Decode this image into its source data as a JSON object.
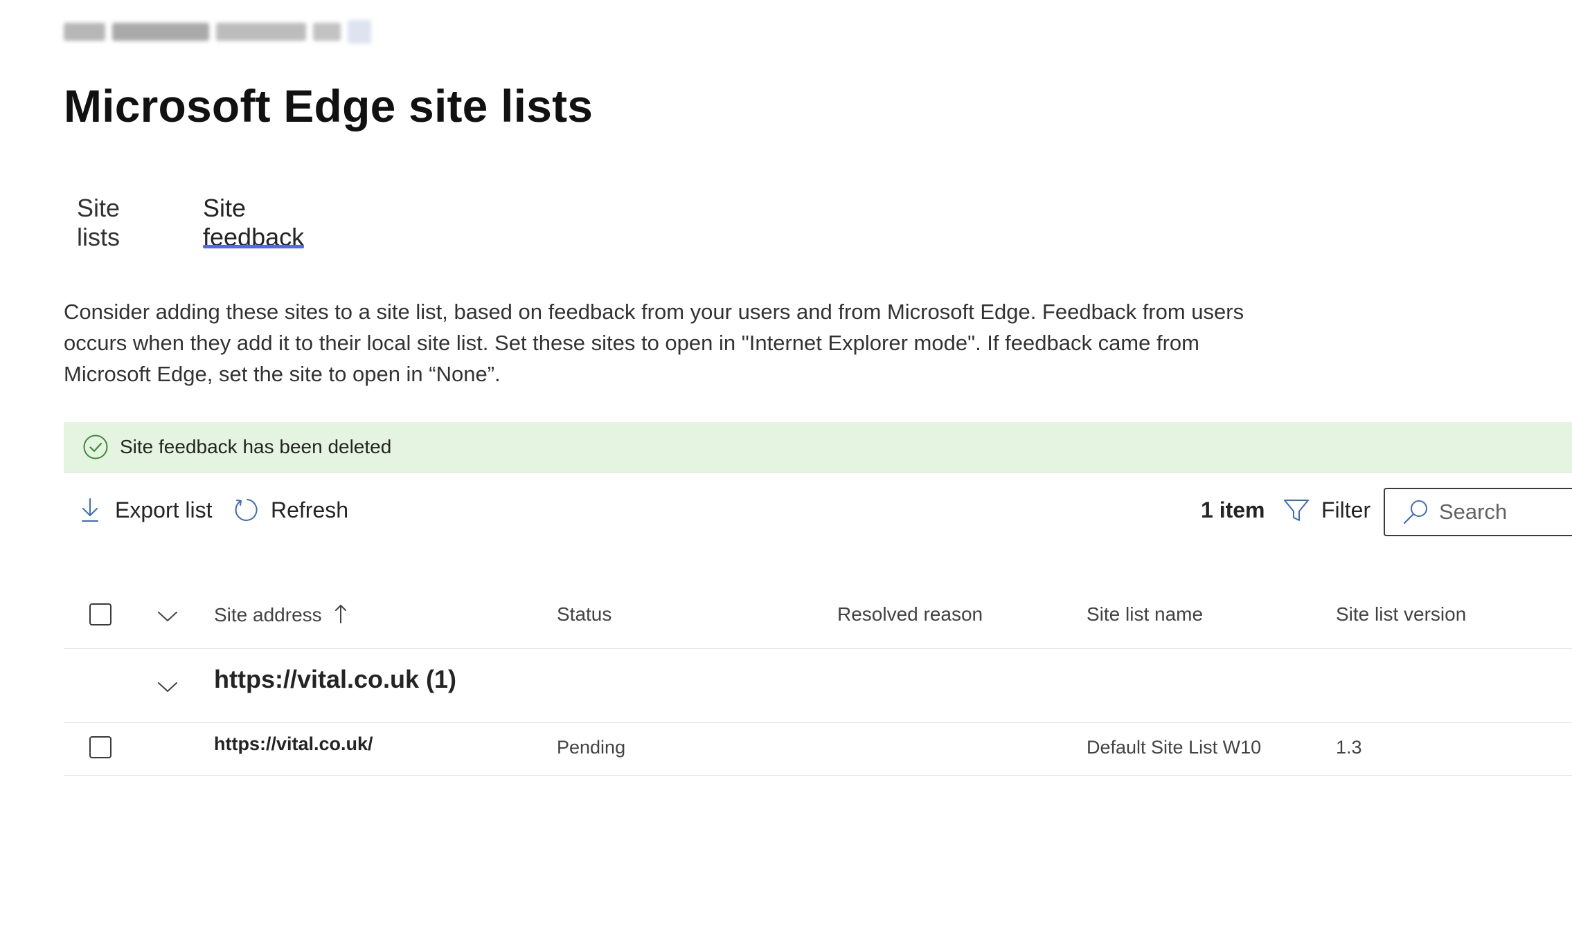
{
  "page": {
    "title": "Microsoft Edge site lists"
  },
  "tabs": [
    {
      "label": "Site lists"
    },
    {
      "label": "Site feedback"
    }
  ],
  "description": "Consider adding these sites to a site list, based on feedback from your users and from Microsoft Edge. Feedback from users occurs when they add it to their local site list. Set these sites to open in \"Internet Explorer mode\". If feedback came from Microsoft Edge, set the site to open in “None”.",
  "banner": {
    "text": "Site feedback has been deleted",
    "icon": "check-circle-icon",
    "color": "#e5f4e0"
  },
  "toolbar": {
    "export_label": "Export list",
    "refresh_label": "Refresh",
    "item_count": "1 item",
    "filter_label": "Filter",
    "search_placeholder": "Search"
  },
  "table": {
    "columns": [
      "Site address",
      "Status",
      "Resolved reason",
      "Site list name",
      "Site list version"
    ],
    "groups": [
      {
        "label": "https://vital.co.uk (1)",
        "rows": [
          {
            "site_address": "https://vital.co.uk/",
            "status": "Pending",
            "resolved_reason": "",
            "site_list_name": "Default Site List W10",
            "site_list_version": "1.3"
          }
        ]
      }
    ]
  },
  "colors": {
    "accent": "#4f6bed",
    "success_bg": "#e5f4e0",
    "icon_blue": "#3b6bc4",
    "success_icon": "#3c8a38"
  }
}
